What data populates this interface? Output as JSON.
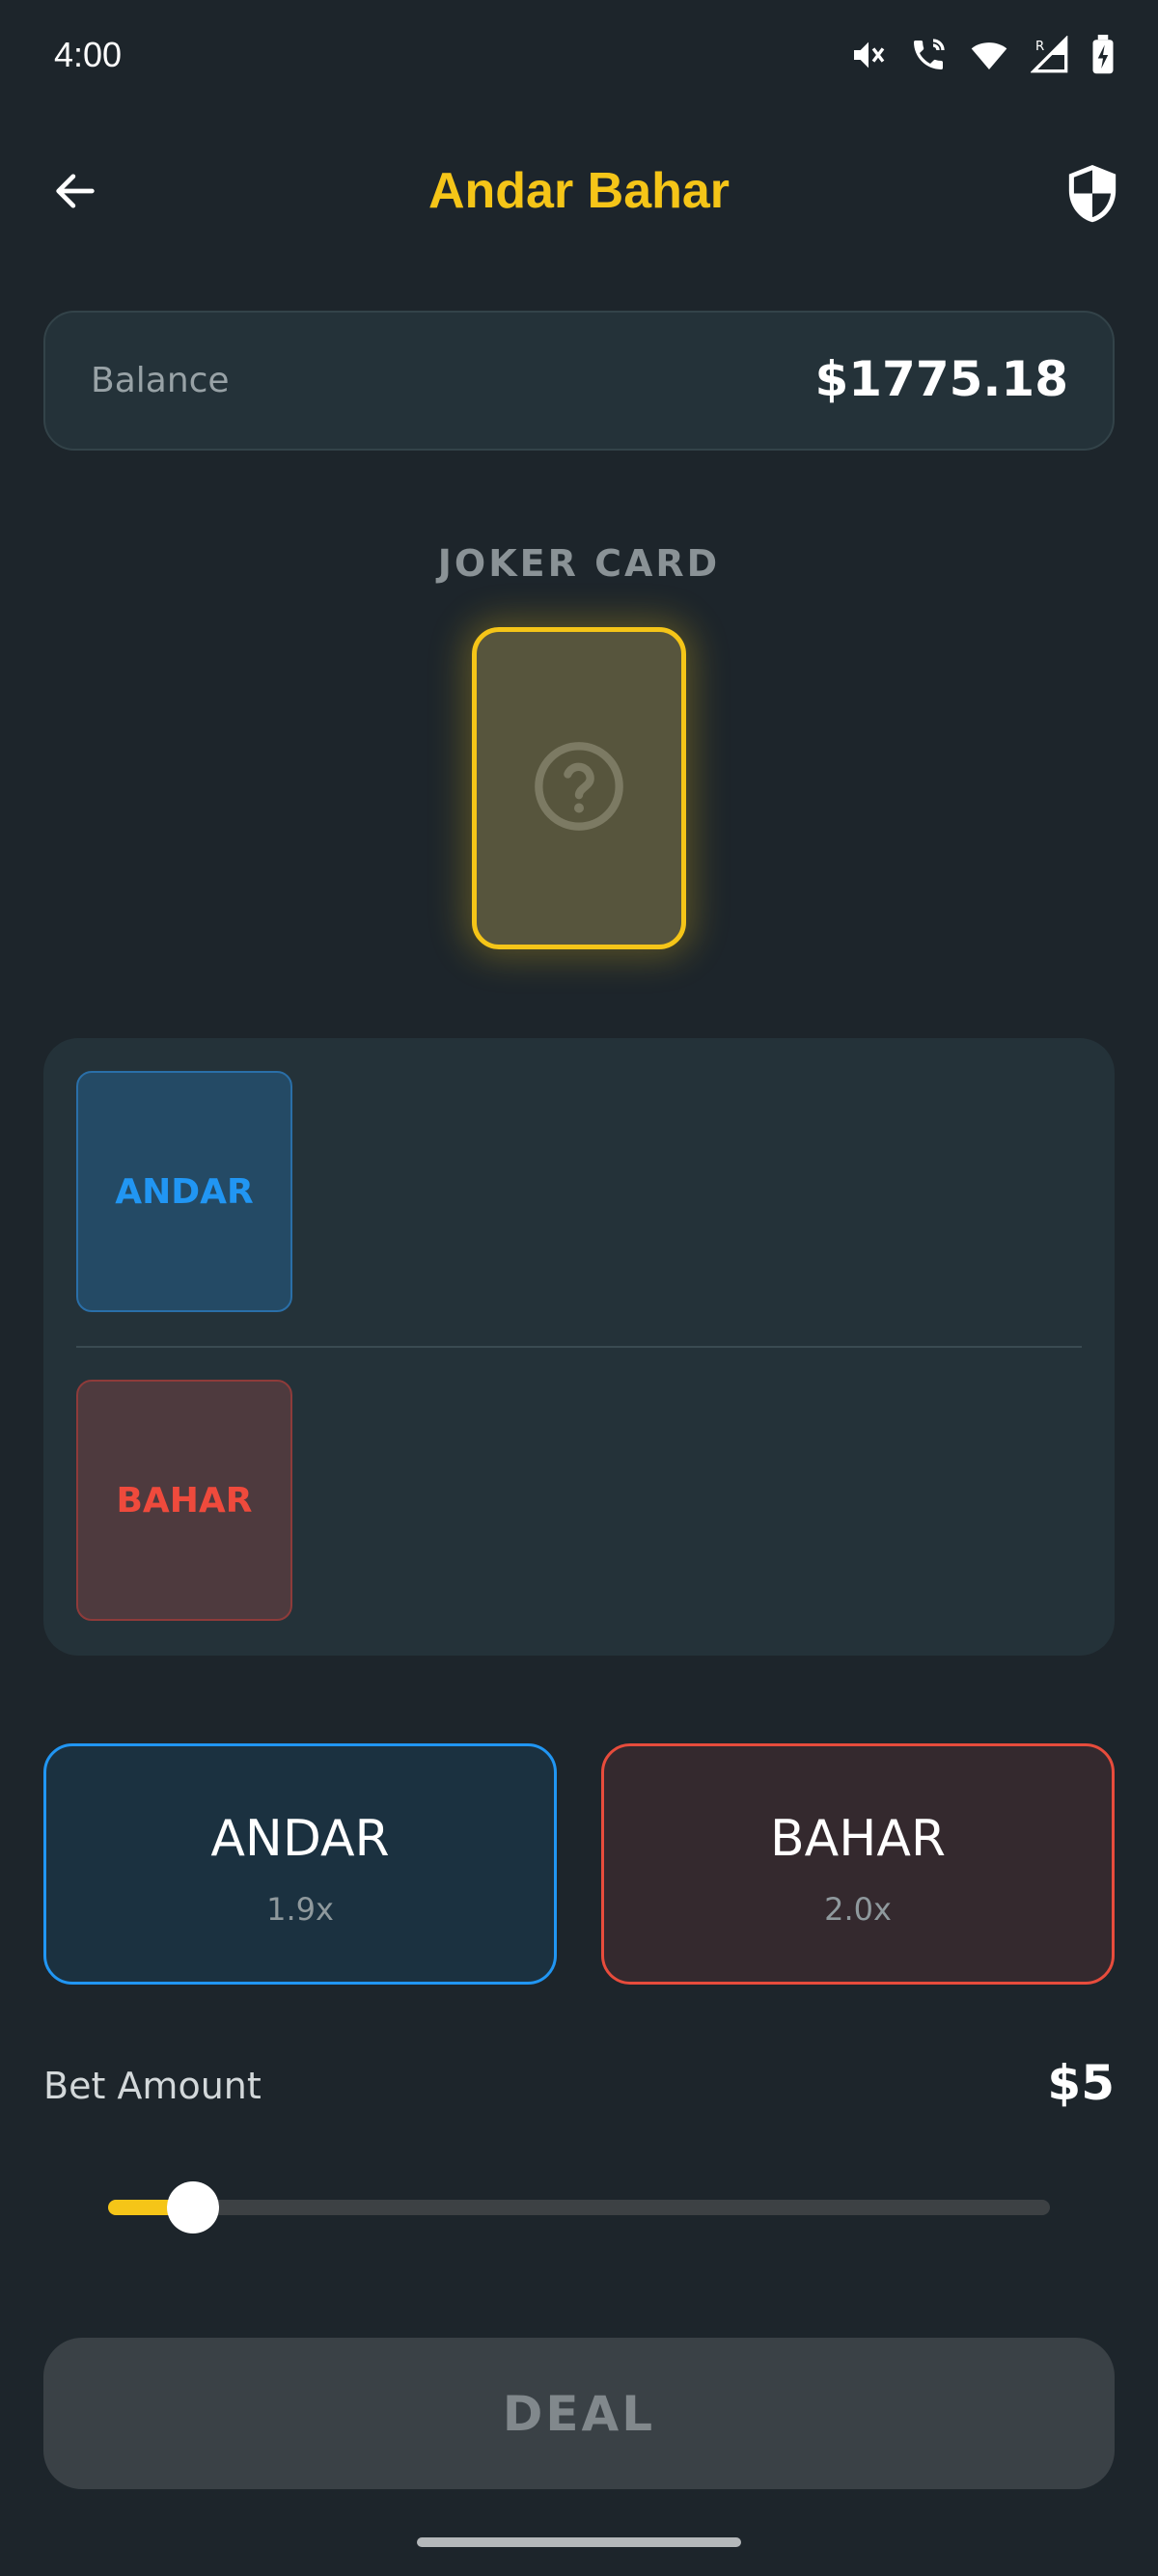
{
  "status_bar": {
    "time": "4:00",
    "icons": [
      "mute-icon",
      "wifi-call-icon",
      "wifi-icon",
      "signal-icon",
      "battery-charging-icon"
    ]
  },
  "app_bar": {
    "title": "Andar Bahar",
    "back_icon": "arrow-left-icon",
    "shield_icon": "shield-icon"
  },
  "balance": {
    "label": "Balance",
    "value": "$1775.18"
  },
  "joker": {
    "label": "JOKER CARD",
    "icon": "question-circle-icon"
  },
  "board": {
    "andar_label": "ANDAR",
    "bahar_label": "BAHAR"
  },
  "bets": {
    "andar": {
      "label": "ANDAR",
      "multiplier": "1.9x"
    },
    "bahar": {
      "label": "BAHAR",
      "multiplier": "2.0x"
    }
  },
  "bet_amount": {
    "label": "Bet Amount",
    "value": "$5",
    "slider_fraction": 0.09
  },
  "deal": {
    "label": "DEAL"
  },
  "colors": {
    "background": "#1d252b",
    "accent_gold": "#f5c518",
    "andar_blue": "#2196f3",
    "bahar_red": "#e74c3c"
  }
}
